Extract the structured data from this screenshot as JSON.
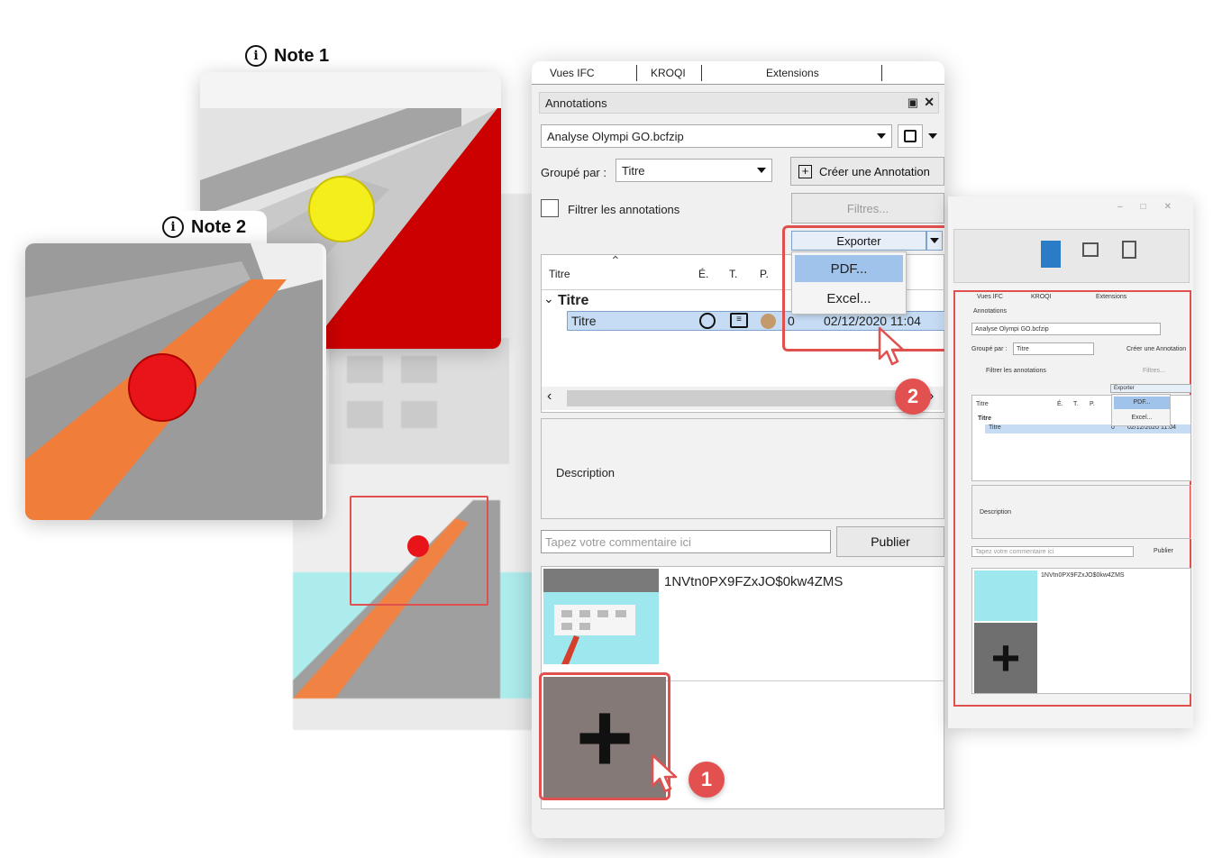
{
  "notes": [
    {
      "label": "Note 1",
      "marker_color": "#f4ee1c"
    },
    {
      "label": "Note 2",
      "marker_color": "#e8141a"
    }
  ],
  "panel": {
    "tabs": [
      "Vues IFC",
      "KROQI",
      "Extensions"
    ],
    "title": "Annotations",
    "title_icons": [
      "restore-icon",
      "close-icon"
    ],
    "file": "Analyse Olympi GO.bcfzip",
    "group_by_label": "Groupé par :",
    "group_by_value": "Titre",
    "create_button": "Créer une Annotation",
    "filter_checkbox": "Filtrer les annotations",
    "filters_button": "Filtres...",
    "export_button": "Exporter",
    "export_menu": [
      "PDF...",
      "Excel..."
    ],
    "columns": [
      "Titre",
      "É.",
      "T.",
      "P."
    ],
    "group_row": "Titre",
    "row": {
      "title": "Titre",
      "count": "0",
      "date": "02/12/2020 11:04"
    },
    "description_label": "Description",
    "comment_placeholder": "Tapez votre commentaire ici",
    "publish_button": "Publier",
    "snapshot_id": "1NVtn0PX9FZxJO$0kw4ZMS",
    "add_symbol": "+"
  },
  "badges": [
    "1",
    "2"
  ],
  "colors": {
    "accent_red": "#e2514f",
    "selection_blue": "#c6dcf4",
    "status_brown": "#c49a6c"
  },
  "mini": {
    "tabs": [
      "Vues IFC",
      "KROQI",
      "Extensions"
    ],
    "title": "Annotations",
    "file": "Analyse Olympi GO.bcfzip",
    "group_by_label": "Groupé par :",
    "group_by_value": "Titre",
    "create_button": "Créer une Annotation",
    "filter_checkbox": "Filtrer les annotations",
    "filters_button": "Filtres...",
    "export_button": "Exporter",
    "export_menu": [
      "PDF...",
      "Excel..."
    ],
    "columns": [
      "Titre",
      "É.",
      "T.",
      "P."
    ],
    "group_row": "Titre",
    "row": {
      "title": "Titre",
      "count": "0",
      "date": "02/12/2020 11:04"
    },
    "description_label": "Description",
    "comment_placeholder": "Tapez votre commentaire ici",
    "publish_button": "Publier",
    "snapshot_id": "1NVtn0PX9FZxJO$0kw4ZMS",
    "add_symbol": "+"
  }
}
